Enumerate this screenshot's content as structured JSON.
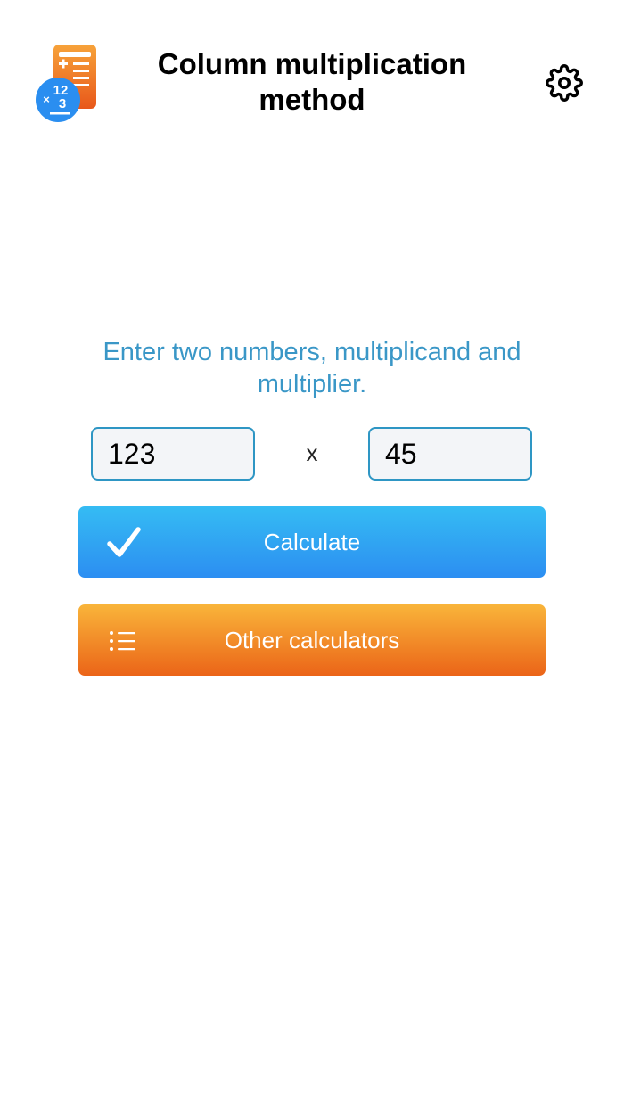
{
  "header": {
    "title_line1": "Column multiplication",
    "title_line2": "method",
    "app_icon": "calculator-multiplication-icon",
    "app_icon_text_top": "12",
    "app_icon_text_mid": "3",
    "app_icon_times": "×",
    "settings_icon": "gear-icon"
  },
  "main": {
    "instruction": "Enter two numbers, multiplicand and multiplier.",
    "multiplicand": "123",
    "multiplier": "45",
    "times_symbol": "x"
  },
  "buttons": {
    "calculate_label": "Calculate",
    "calculate_icon": "checkmark-icon",
    "other_label": "Other calculators",
    "other_icon": "list-icon"
  },
  "colors": {
    "accent_text": "#3a97c7",
    "calculate_gradient": [
      "#35bcf3",
      "#2c8ef2"
    ],
    "other_gradient": [
      "#f9b53a",
      "#eb6418"
    ],
    "input_border": "#2e96c4",
    "input_bg": "#f3f5f8"
  }
}
